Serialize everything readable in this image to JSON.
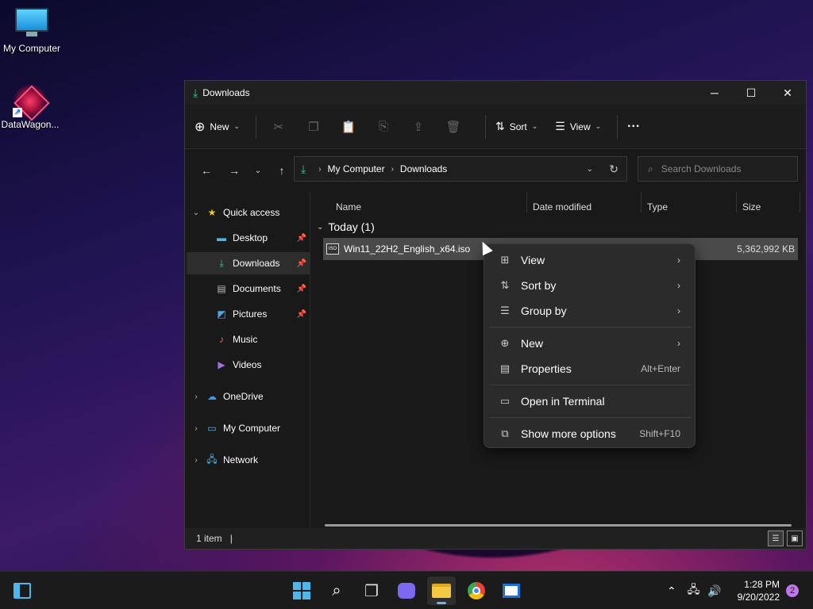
{
  "desktop": {
    "icons": [
      {
        "label": "My Computer",
        "icon": "monitor-icon"
      },
      {
        "label": "DataWagon...",
        "icon": "datawagon-icon"
      }
    ]
  },
  "window": {
    "title": "Downloads",
    "controls": {
      "minimize": "─",
      "maximize": "☐",
      "close": "✕"
    }
  },
  "toolbar": {
    "new_label": "New",
    "sort_label": "Sort",
    "view_label": "View",
    "more_label": "···"
  },
  "address": {
    "crumbs": [
      "My Computer",
      "Downloads"
    ],
    "search_placeholder": "Search Downloads"
  },
  "sidebar": {
    "quick_access": "Quick access",
    "items": [
      {
        "label": "Desktop",
        "pinned": true
      },
      {
        "label": "Downloads",
        "pinned": true,
        "selected": true
      },
      {
        "label": "Documents",
        "pinned": true
      },
      {
        "label": "Pictures",
        "pinned": true
      },
      {
        "label": "Music",
        "pinned": false
      },
      {
        "label": "Videos",
        "pinned": false
      }
    ],
    "roots": [
      "OneDrive",
      "My Computer",
      "Network"
    ]
  },
  "columns": [
    "Name",
    "Date modified",
    "Type",
    "Size"
  ],
  "group": "Today (1)",
  "files": [
    {
      "name": "Win11_22H2_English_x64.iso",
      "size": "5,362,992 KB"
    }
  ],
  "status": {
    "count": "1 item"
  },
  "context_menu": {
    "items": [
      {
        "label": "View",
        "submenu": true
      },
      {
        "label": "Sort by",
        "submenu": true
      },
      {
        "label": "Group by",
        "submenu": true
      },
      {
        "label": "New",
        "submenu": true
      },
      {
        "label": "Properties",
        "shortcut": "Alt+Enter"
      },
      {
        "label": "Open in Terminal"
      },
      {
        "label": "Show more options",
        "shortcut": "Shift+F10"
      }
    ]
  },
  "taskbar": {
    "time": "1:28 PM",
    "date": "9/20/2022",
    "notifications": "2"
  }
}
